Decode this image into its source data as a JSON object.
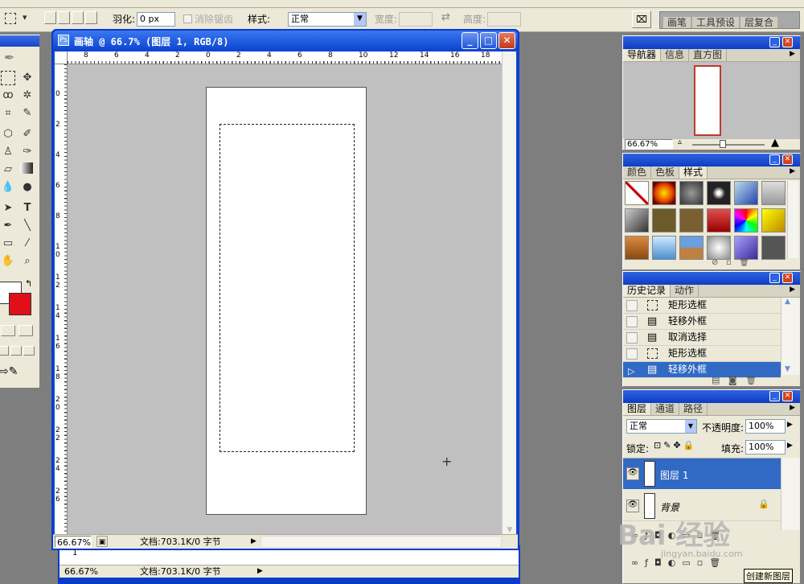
{
  "options_bar": {
    "feather_label": "羽化:",
    "feather_value": "0 px",
    "anti_alias_label": "消除锯齿",
    "style_label": "样式:",
    "style_value": "正常",
    "width_label": "宽度:",
    "height_label": "高度:",
    "palette_tabs": [
      "画笔",
      "工具预设",
      "层复合"
    ]
  },
  "document": {
    "title": "画轴 @ 66.7% (图层 1, RGB/8)",
    "zoom": "66.67%",
    "doc_info": "文档:703.1K/0 字节",
    "ruler_h_labels": [
      "8",
      "6",
      "4",
      "2",
      "0",
      "2",
      "4",
      "6",
      "8",
      "10",
      "12",
      "14",
      "16",
      "18"
    ],
    "ruler_v_labels": [
      "0",
      "2",
      "4",
      "6",
      "8",
      "1 0",
      "1 2",
      "1 4",
      "1 6",
      "1 8",
      "2 0",
      "2 2",
      "2 4",
      "2 6"
    ]
  },
  "background_window": {
    "zoom": "66.67%",
    "doc_info": "文档:703.1K/0 字节"
  },
  "navigator": {
    "tabs": [
      "导航器",
      "信息",
      "直方图"
    ],
    "zoom": "66.67%"
  },
  "color_panel": {
    "tabs": [
      "颜色",
      "色板",
      "样式"
    ]
  },
  "history": {
    "tabs": [
      "历史记录",
      "动作"
    ],
    "items": [
      "矩形选框",
      "轻移外框",
      "取消选择",
      "矩形选框",
      "轻移外框"
    ]
  },
  "layers": {
    "tabs": [
      "图层",
      "通道",
      "路径"
    ],
    "blend_mode": "正常",
    "opacity_label": "不透明度:",
    "opacity_value": "100%",
    "lock_label": "锁定:",
    "fill_label": "填充:",
    "fill_value": "100%",
    "items": [
      "图层 1",
      "背景"
    ],
    "new_layer_tooltip": "创建新图层"
  },
  "watermark": {
    "text": "Bai 经验",
    "url": "jingyan.baidu.com"
  },
  "colors": {
    "foreground": "#ffffff",
    "background": "#e0101a",
    "selection": "#316ac5",
    "canvas_bg": "#c0c0c0"
  }
}
